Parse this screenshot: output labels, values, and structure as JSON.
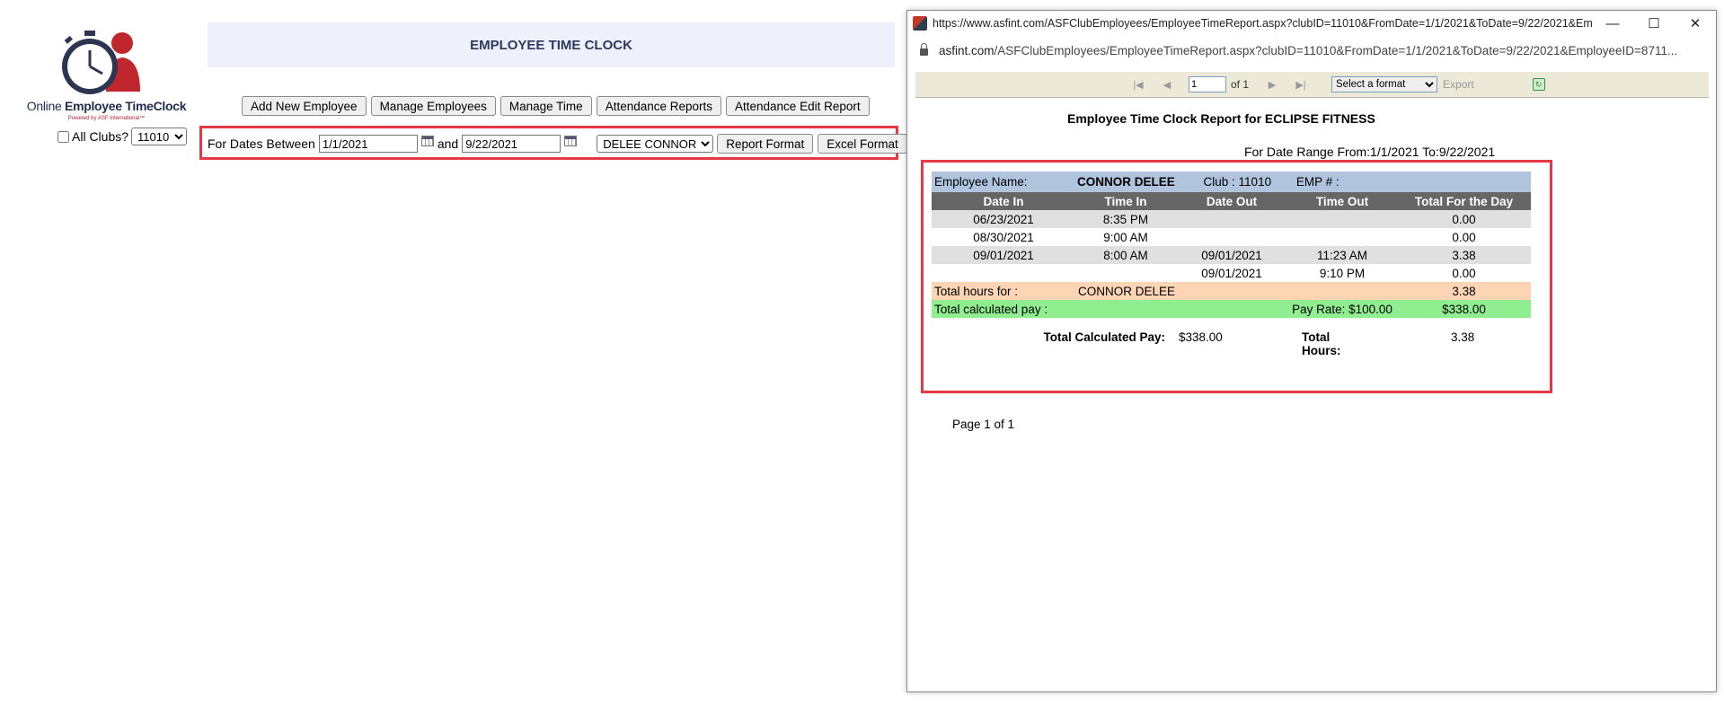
{
  "logo": {
    "line1_prefix": "Online ",
    "line1_bold": "Employee TimeClock",
    "powered": "Powered by ASF International™"
  },
  "clubs": {
    "all_label": "All Clubs?",
    "selected": "11010"
  },
  "app": {
    "title": "EMPLOYEE TIME CLOCK"
  },
  "nav": {
    "add_employee": "Add New Employee",
    "manage_employees": "Manage Employees",
    "manage_time": "Manage Time",
    "attendance_reports": "Attendance Reports",
    "attendance_edit_report": "Attendance Edit Report"
  },
  "filter": {
    "label": "For Dates Between",
    "from": "1/1/2021",
    "and": "and",
    "to": "9/22/2021",
    "employee": "DELEE CONNOR",
    "report_format": "Report Format",
    "excel_format": "Excel Format"
  },
  "popup": {
    "title": "https://www.asfint.com/ASFClubEmployees/EmployeeTimeReport.aspx?clubID=11010&FromDate=1/1/2021&ToDate=9/22/2021&Employ...",
    "address_host": "asfint.com",
    "address_path": "/ASFClubEmployees/EmployeeTimeReport.aspx?clubID=11010&FromDate=1/1/2021&ToDate=9/22/2021&EmployeeID=8711...",
    "minimize": "—",
    "maximize": "☐",
    "close": "✕"
  },
  "toolbar": {
    "first_icon": "first-page-icon",
    "prev_icon": "prev-page-icon",
    "page": "1",
    "of": "of 1",
    "next_icon": "next-page-icon",
    "last_icon": "last-page-icon",
    "format_placeholder": "Select a format",
    "export": "Export"
  },
  "report": {
    "title": "Employee Time Clock Report for ECLIPSE FITNESS",
    "range": "For Date Range From:1/1/2021 To:9/22/2021",
    "emp_name_label": "Employee Name:",
    "emp_name": "CONNOR DELEE",
    "club": "Club : 11010",
    "emp_no": "EMP # :",
    "headers": [
      "Date In",
      "Time In",
      "Date Out",
      "Time Out",
      "Total For the Day"
    ],
    "rows": [
      [
        "06/23/2021",
        "8:35 PM",
        "",
        "",
        "0.00"
      ],
      [
        "08/30/2021",
        "9:00 AM",
        "",
        "",
        "0.00"
      ],
      [
        "09/01/2021",
        "8:00 AM",
        "09/01/2021",
        "11:23 AM",
        "3.38"
      ],
      [
        "",
        "",
        "09/01/2021",
        "9:10 PM",
        "0.00"
      ]
    ],
    "total_hours_label": "Total hours for :",
    "total_hours_name": "CONNOR DELEE",
    "total_hours_value": "3.38",
    "total_pay_label": "Total calculated pay :",
    "pay_rate": "Pay Rate: $100.00",
    "total_pay_value": "$338.00",
    "grand_pay_label": "Total Calculated Pay:",
    "grand_pay_value": "$338.00",
    "grand_hours_label_1": "Total",
    "grand_hours_label_2": "Hours:",
    "grand_hours_value": "3.38",
    "page_of": "Page 1 of 1"
  },
  "colors": {
    "highlight": "#e63946",
    "emp_row": "#b0c4de",
    "header_row": "#666666",
    "total_row": "#fcd5b4",
    "pay_row": "#90ee90"
  }
}
